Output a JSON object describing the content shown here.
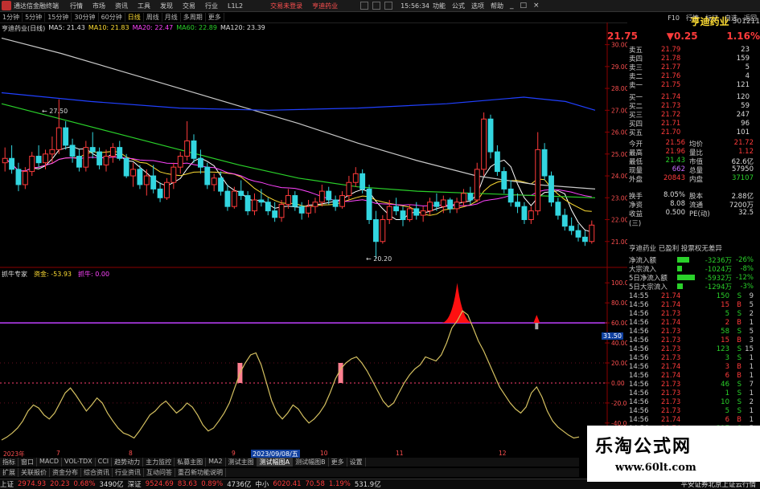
{
  "menubar": {
    "app_title": "通达信金融终端",
    "items": [
      "行情",
      "市场",
      "资讯",
      "工具",
      "发现",
      "交易",
      "行业",
      "L1L2"
    ],
    "login": "交易未登录",
    "stock_name": "亨迪药业",
    "time": "15:56:34",
    "right_items": [
      "功能",
      "公式",
      "选项",
      "帮助"
    ]
  },
  "toolbar": {
    "items": [
      "1分钟",
      "5分钟",
      "15分钟",
      "30分钟",
      "60分钟",
      "日线",
      "周线",
      "月线",
      "多周期",
      "更多"
    ],
    "active": "日线"
  },
  "rtoolbar": {
    "items": [
      "F10",
      "行情",
      "标记",
      "自选",
      "返回"
    ]
  },
  "chart_title": {
    "name": "亨迪药业(日线)",
    "ma5": "MA5: 21.43",
    "ma10": "MA10: 21.83",
    "ma20": "MA20: 22.47",
    "ma60": "MA60: 22.89",
    "ma120": "MA120: 23.39"
  },
  "price_axis": [
    "30.00",
    "29.00",
    "28.00",
    "27.00",
    "26.00",
    "25.00",
    "24.00",
    "23.00",
    "22.00",
    "21.00"
  ],
  "price_marks": {
    "high": "27.50",
    "low": "20.20"
  },
  "indicator": {
    "title": "抓牛专家",
    "v1_label": "资金: -53.93",
    "v2_label": "抓牛: 0.00",
    "axis": [
      "100.00",
      "80.00",
      "60.00",
      "40.00",
      "20.00",
      "0.00",
      "-20.00",
      "-40.00",
      "-60.00"
    ],
    "cursor_value": "31.50"
  },
  "dates": [
    "2023年",
    "7",
    "8",
    "9",
    "2023/09/08/五",
    "10",
    "11",
    "12"
  ],
  "right_panel": {
    "name": "亨迪药业",
    "code": "301211",
    "price": "21.75",
    "change": "▼0.25",
    "pct": "1.16%",
    "asks": [
      {
        "lbl": "卖五",
        "pr": "21.79",
        "vol": "23"
      },
      {
        "lbl": "卖四",
        "pr": "21.78",
        "vol": "159"
      },
      {
        "lbl": "卖三",
        "pr": "21.77",
        "vol": "5"
      },
      {
        "lbl": "卖二",
        "pr": "21.76",
        "vol": "4"
      },
      {
        "lbl": "卖一",
        "pr": "21.75",
        "vol": "121"
      }
    ],
    "bids": [
      {
        "lbl": "买一",
        "pr": "21.74",
        "vol": "120"
      },
      {
        "lbl": "买二",
        "pr": "21.73",
        "vol": "59"
      },
      {
        "lbl": "买三",
        "pr": "21.72",
        "vol": "247"
      },
      {
        "lbl": "买四",
        "pr": "21.71",
        "vol": "96"
      },
      {
        "lbl": "买五",
        "pr": "21.70",
        "vol": "101"
      }
    ],
    "stats": [
      {
        "k": "今开",
        "v": "21.56",
        "vc": "red",
        "k2": "均价",
        "v2": "21.72",
        "v2c": "red"
      },
      {
        "k": "最高",
        "v": "21.96",
        "vc": "red",
        "k2": "量比",
        "v2": "1.12",
        "v2c": "red"
      },
      {
        "k": "最低",
        "v": "21.43",
        "vc": "green",
        "k2": "市值",
        "v2": "62.6亿",
        "v2c": "white"
      },
      {
        "k": "现量",
        "v": "662",
        "vc": "purple",
        "k2": "总量",
        "v2": "57950",
        "v2c": "white"
      },
      {
        "k": "外盘",
        "v": "20843",
        "vc": "red",
        "k2": "内盘",
        "v2": "37107",
        "v2c": "green"
      }
    ],
    "stats2": [
      {
        "k": "换手",
        "v": "8.05%",
        "vc": "white",
        "k2": "股本",
        "v2": "2.88亿",
        "v2c": "white"
      },
      {
        "k": "净资",
        "v": "8.08",
        "vc": "white",
        "k2": "流通",
        "v2": "7200万",
        "v2c": "white"
      },
      {
        "k": "收益(三)",
        "v": "0.500",
        "vc": "white",
        "k2": "PE(动)",
        "v2": "32.5",
        "v2c": "white"
      }
    ],
    "profile": "亨迪药业 已盈利 投票权无差异",
    "flows": [
      {
        "k": "净流入额",
        "v": "-3236万",
        "p": "-26%",
        "w": 0.55
      },
      {
        "k": "大宗流入",
        "v": "-1024万",
        "p": "-8%",
        "w": 0.2
      },
      {
        "k": "5日净流入额",
        "v": "-5932万",
        "p": "-12%",
        "w": 0.8
      },
      {
        "k": "5日大宗流入",
        "v": "-1294万",
        "p": "-3%",
        "w": 0.25
      }
    ],
    "ticks": [
      {
        "t": "14:55",
        "p": "21.74",
        "v": "150",
        "s": "S",
        "sc": "green",
        "n": "9"
      },
      {
        "t": "14:56",
        "p": "21.74",
        "v": "15",
        "s": "B",
        "sc": "red",
        "n": "5"
      },
      {
        "t": "14:56",
        "p": "21.73",
        "v": "5",
        "s": "S",
        "sc": "green",
        "n": "2"
      },
      {
        "t": "14:56",
        "p": "21.74",
        "v": "2",
        "s": "B",
        "sc": "red",
        "n": "1"
      },
      {
        "t": "14:56",
        "p": "21.73",
        "v": "58",
        "s": "S",
        "sc": "green",
        "n": "5"
      },
      {
        "t": "14:56",
        "p": "21.73",
        "v": "15",
        "s": "B",
        "sc": "red",
        "n": "3"
      },
      {
        "t": "14:56",
        "p": "21.73",
        "v": "123",
        "s": "S",
        "sc": "green",
        "n": "15"
      },
      {
        "t": "14:56",
        "p": "21.73",
        "v": "3",
        "s": "S",
        "sc": "green",
        "n": "1"
      },
      {
        "t": "14:56",
        "p": "21.74",
        "v": "3",
        "s": "B",
        "sc": "red",
        "n": "1"
      },
      {
        "t": "14:56",
        "p": "21.74",
        "v": "6",
        "s": "B",
        "sc": "red",
        "n": "1"
      },
      {
        "t": "14:56",
        "p": "21.73",
        "v": "46",
        "s": "S",
        "sc": "green",
        "n": "7"
      },
      {
        "t": "14:56",
        "p": "21.73",
        "v": "1",
        "s": "S",
        "sc": "green",
        "n": "1"
      },
      {
        "t": "14:56",
        "p": "21.73",
        "v": "10",
        "s": "S",
        "sc": "green",
        "n": "2"
      },
      {
        "t": "14:56",
        "p": "21.73",
        "v": "5",
        "s": "S",
        "sc": "green",
        "n": "1"
      },
      {
        "t": "14:56",
        "p": "21.74",
        "v": "6",
        "s": "B",
        "sc": "red",
        "n": "1"
      },
      {
        "t": "14:56",
        "p": "21.74",
        "v": "217",
        "s": "S",
        "sc": "green",
        "n": "5"
      }
    ]
  },
  "bottom_tabs": [
    "指标",
    "窗口",
    "MACD",
    "VOL-TDX",
    "CCI",
    "趋势动力",
    "主力监控",
    "私募主图",
    "MA2",
    "测试主图",
    "测试幅图A",
    "测试幅图B",
    "更多",
    "设置"
  ],
  "ind_tabs": [
    "扩展",
    "关联报价",
    "资金分布",
    "综合资讯",
    "行业资讯",
    "互动问答",
    "重召新功能说明"
  ],
  "status": {
    "sh_label": "上证",
    "sh_val": "2974.93",
    "sh_chg": "20.23",
    "sh_pct": "0.68%",
    "sh_amt": "3490亿",
    "sz_label": "深证",
    "sz_val": "9524.69",
    "sz_chg": "83.63",
    "sz_pct": "0.89%",
    "sz_amt": "4736亿",
    "zx_label": "中小",
    "zx_val": "6020.41",
    "zx_chg": "70.58",
    "zx_pct": "1.19%",
    "zx_amt": "531.9亿",
    "broker": "平安证券北京上证云行情"
  },
  "watermark": {
    "title": "乐淘公式网",
    "url": "www.60lt.com"
  },
  "chart_data": [
    {
      "type": "candlestick",
      "title": "亨迪药业(日线)",
      "series_ma": [
        "MA5",
        "MA10",
        "MA20",
        "MA60",
        "MA120"
      ],
      "ylim": [
        20,
        30.5
      ],
      "ohlc": [
        [
          24.6,
          25.3,
          24.2,
          24.8
        ],
        [
          24.8,
          25.4,
          24.1,
          24.3
        ],
        [
          24.3,
          24.6,
          23.3,
          23.6
        ],
        [
          23.6,
          24.4,
          23.4,
          24.2
        ],
        [
          24.2,
          25.1,
          24.0,
          24.9
        ],
        [
          24.9,
          25.4,
          24.4,
          24.6
        ],
        [
          24.6,
          25.2,
          24.3,
          25.0
        ],
        [
          25.0,
          25.8,
          24.6,
          25.2
        ],
        [
          25.2,
          27.5,
          25.0,
          26.2
        ],
        [
          26.2,
          26.5,
          25.2,
          25.4
        ],
        [
          25.4,
          25.7,
          24.6,
          24.9
        ],
        [
          24.9,
          25.2,
          24.2,
          24.4
        ],
        [
          24.4,
          25.6,
          24.2,
          25.3
        ],
        [
          25.3,
          26.0,
          24.8,
          25.1
        ],
        [
          25.1,
          25.3,
          24.3,
          24.5
        ],
        [
          24.5,
          25.2,
          24.2,
          24.9
        ],
        [
          24.9,
          25.5,
          24.6,
          25.3
        ],
        [
          25.3,
          25.6,
          24.7,
          24.8
        ],
        [
          24.8,
          25.0,
          23.9,
          24.0
        ],
        [
          24.0,
          24.6,
          23.5,
          24.3
        ],
        [
          24.3,
          24.5,
          23.4,
          23.6
        ],
        [
          23.6,
          24.3,
          23.1,
          24.0
        ],
        [
          24.0,
          24.5,
          23.2,
          23.4
        ],
        [
          23.4,
          23.7,
          22.8,
          23.0
        ],
        [
          23.0,
          23.9,
          22.9,
          23.7
        ],
        [
          23.7,
          24.6,
          23.4,
          24.4
        ],
        [
          24.4,
          25.1,
          24.1,
          24.9
        ],
        [
          24.9,
          26.5,
          24.7,
          25.6
        ],
        [
          25.6,
          25.9,
          24.6,
          24.8
        ],
        [
          24.8,
          25.2,
          24.1,
          24.4
        ],
        [
          24.4,
          24.6,
          23.4,
          23.6
        ],
        [
          23.6,
          24.1,
          23.3,
          23.9
        ],
        [
          23.9,
          24.2,
          23.1,
          23.3
        ],
        [
          23.3,
          23.6,
          22.4,
          22.6
        ],
        [
          22.6,
          23.5,
          22.5,
          23.3
        ],
        [
          23.3,
          23.8,
          22.9,
          23.1
        ],
        [
          23.1,
          23.3,
          22.2,
          22.4
        ],
        [
          22.4,
          23.2,
          22.2,
          22.9
        ],
        [
          22.9,
          23.4,
          22.6,
          22.8
        ],
        [
          22.8,
          23.0,
          22.2,
          22.4
        ],
        [
          22.4,
          22.8,
          21.9,
          22.1
        ],
        [
          22.1,
          22.9,
          21.9,
          22.7
        ],
        [
          22.7,
          23.4,
          22.5,
          23.1
        ],
        [
          23.1,
          23.3,
          22.4,
          22.6
        ],
        [
          22.6,
          22.8,
          22.0,
          22.3
        ],
        [
          22.3,
          22.9,
          22.1,
          22.6
        ],
        [
          22.6,
          23.0,
          22.3,
          22.8
        ],
        [
          22.8,
          23.6,
          22.6,
          23.3
        ],
        [
          23.3,
          23.5,
          22.7,
          22.9
        ],
        [
          22.9,
          23.1,
          22.4,
          22.6
        ],
        [
          22.6,
          23.3,
          22.5,
          23.1
        ],
        [
          23.1,
          24.0,
          22.9,
          23.7
        ],
        [
          23.7,
          24.4,
          23.5,
          24.1
        ],
        [
          24.1,
          24.3,
          23.2,
          23.4
        ],
        [
          23.4,
          23.6,
          21.8,
          22.0
        ],
        [
          22.0,
          22.4,
          20.2,
          21.0
        ],
        [
          21.0,
          22.2,
          20.9,
          22.0
        ],
        [
          22.0,
          22.9,
          21.8,
          22.6
        ],
        [
          22.6,
          23.0,
          22.2,
          22.4
        ],
        [
          22.4,
          22.6,
          21.7,
          22.0
        ],
        [
          22.0,
          22.7,
          21.9,
          22.5
        ],
        [
          22.5,
          22.8,
          22.0,
          22.2
        ],
        [
          22.2,
          22.6,
          21.9,
          22.4
        ],
        [
          22.4,
          23.0,
          22.2,
          22.8
        ],
        [
          22.8,
          23.2,
          22.4,
          22.6
        ],
        [
          22.6,
          23.1,
          22.3,
          22.9
        ],
        [
          22.9,
          23.0,
          22.3,
          22.5
        ],
        [
          22.5,
          23.0,
          22.3,
          22.8
        ],
        [
          22.8,
          23.4,
          22.6,
          23.2
        ],
        [
          23.2,
          23.5,
          22.7,
          22.9
        ],
        [
          22.9,
          24.6,
          22.8,
          24.3
        ],
        [
          24.3,
          26.9,
          24.0,
          26.6
        ],
        [
          26.6,
          26.8,
          24.8,
          25.1
        ],
        [
          25.1,
          25.4,
          24.0,
          24.2
        ],
        [
          24.2,
          24.4,
          23.2,
          23.4
        ],
        [
          23.4,
          23.8,
          22.6,
          22.8
        ],
        [
          22.8,
          23.2,
          22.3,
          22.6
        ],
        [
          22.6,
          22.8,
          21.8,
          22.0
        ],
        [
          22.0,
          22.6,
          21.8,
          22.4
        ],
        [
          22.4,
          26.0,
          22.2,
          25.2
        ],
        [
          25.2,
          25.5,
          23.8,
          24.0
        ],
        [
          24.0,
          24.2,
          22.6,
          22.8
        ],
        [
          22.8,
          23.0,
          22.0,
          22.2
        ],
        [
          22.2,
          22.5,
          21.5,
          21.7
        ],
        [
          21.7,
          22.1,
          21.3,
          21.5
        ],
        [
          21.5,
          21.8,
          21.0,
          21.2
        ],
        [
          21.2,
          21.5,
          20.8,
          21.0
        ],
        [
          21.0,
          21.96,
          20.9,
          21.75
        ]
      ]
    },
    {
      "type": "line",
      "title": "抓牛专家",
      "series": [
        {
          "name": "资金",
          "values": [
            -57,
            -54,
            -50,
            -45,
            -38,
            -28,
            -22,
            -25,
            -32,
            -36,
            -30,
            -20,
            -10,
            -5,
            -12,
            -20,
            -28,
            -22,
            -15,
            -20,
            -30,
            -38,
            -45,
            -50,
            -52,
            -55,
            -48,
            -40,
            -32,
            -28,
            -22,
            -18,
            -24,
            -30,
            -26,
            -20,
            -24,
            -32,
            -42,
            -48,
            -45,
            -38,
            -30,
            -20,
            -5,
            10,
            20,
            28,
            30,
            18,
            0,
            -18,
            -30,
            -36,
            -30,
            -22,
            -26,
            -34,
            -40,
            -36,
            -30,
            -22,
            -10,
            4,
            14,
            20,
            24,
            26,
            20,
            12,
            2,
            -8,
            -18,
            -24,
            -20,
            -10,
            0,
            8,
            14,
            18,
            26,
            24,
            22,
            28,
            40,
            55,
            62,
            72,
            68,
            55,
            42,
            32,
            20,
            8,
            -4,
            -12,
            -20,
            -26,
            -30,
            -24,
            -10,
            -4,
            -14,
            -28,
            -38,
            -44,
            -48,
            -52,
            -55,
            -53.93
          ]
        }
      ],
      "markers": [
        {
          "name": "抓牛",
          "value": 0
        }
      ],
      "ylim": [
        -65,
        105
      ]
    }
  ]
}
